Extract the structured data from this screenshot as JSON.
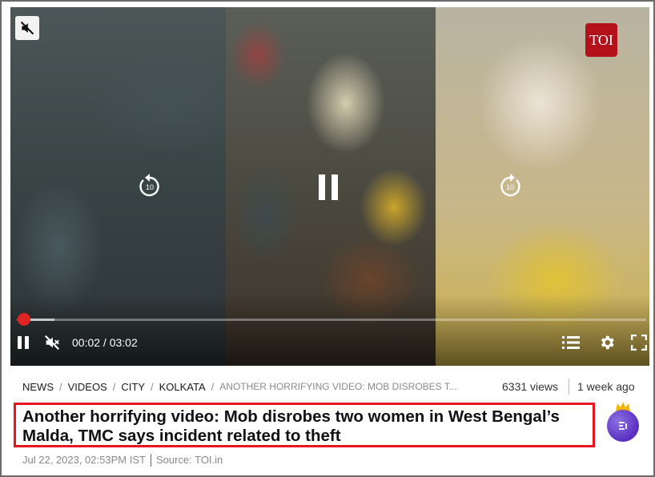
{
  "player": {
    "brand_logo_text": "TOI",
    "time_display": "00:02 / 03:02",
    "progress_fraction": 0.011,
    "buffered_fraction": 0.06,
    "seek_back_seconds": "10",
    "seek_forward_seconds": "10",
    "icons": {
      "mute_badge": "muted-speaker-icon",
      "rewind": "rewind-10-icon",
      "center": "pause-icon",
      "forward": "forward-10-icon",
      "bottom_pause": "pause-icon",
      "bottom_mute": "muted-speaker-icon",
      "playlist": "playlist-icon",
      "settings": "gear-icon",
      "fullscreen": "fullscreen-icon"
    },
    "accent_color": "#e02424"
  },
  "breadcrumb": {
    "items": [
      "NEWS",
      "VIDEOS",
      "CITY",
      "KOLKATA"
    ],
    "current": "ANOTHER HORRIFYING VIDEO: MOB DISROBES T..."
  },
  "meta": {
    "views": "6331 views",
    "ago": "1 week ago"
  },
  "article": {
    "headline": "Another horrifying video: Mob disrobes two women in West Bengal’s Malda, TMC says incident related to theft",
    "published": "Jul 22, 2023, 02:53PM IST",
    "source": "Source: TOI.in",
    "highlight_color": "#e8141e"
  },
  "badge": {
    "icon": "crown-icon",
    "glyph": "𝄞"
  }
}
